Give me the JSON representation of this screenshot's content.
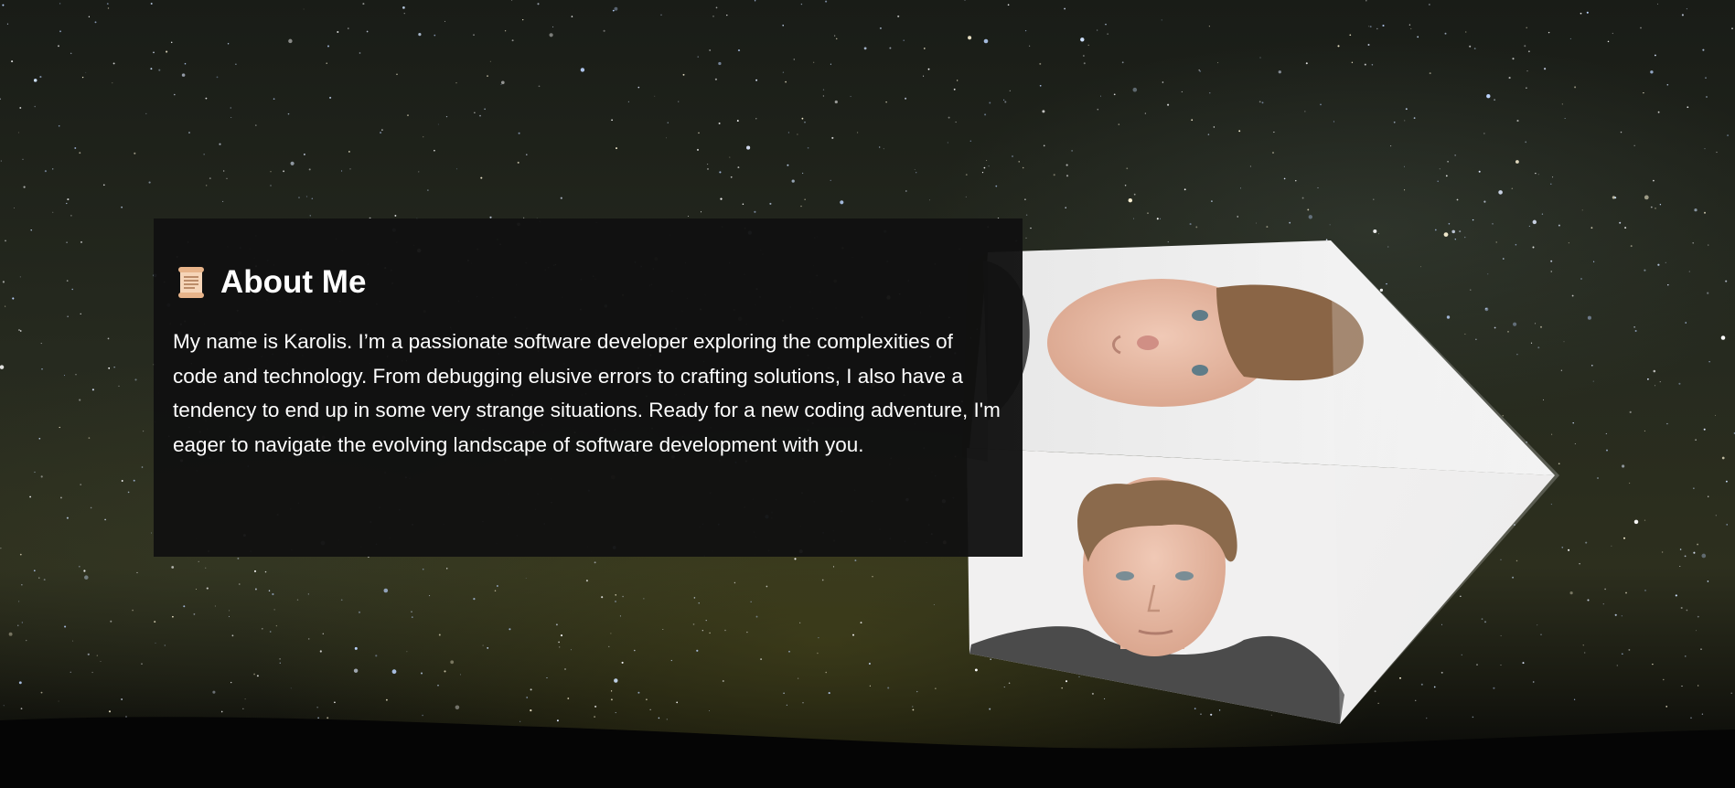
{
  "about": {
    "icon": "scroll-icon",
    "title": "About Me",
    "body": "My name is Karolis. I’m a passionate software developer exploring the complexities of code and technology. From debugging elusive errors to crafting solutions, I also have a tendency to end up in some very strange situations. Ready for a new coding adventure, I'm eager to navigate the evolving landscape of software development with you."
  },
  "background": {
    "description_icon": "starry-night-sky"
  },
  "cube": {
    "faces": [
      "portrait-photo-rotated",
      "portrait-photo-front",
      "white-face"
    ]
  },
  "colors": {
    "panel": "#111111",
    "text": "#ffffff",
    "sky": "#1f231a"
  }
}
